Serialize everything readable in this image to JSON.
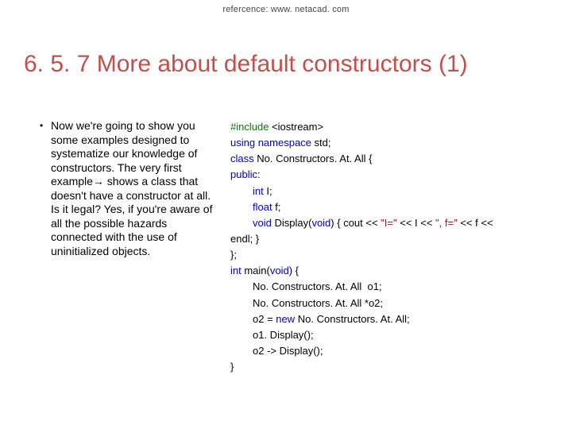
{
  "reference": "refercence: www. netacad. com",
  "title": "6. 5. 7 More about default constructors (1)",
  "bullet": "•",
  "paragraph_lead": "Now we're going to",
  "paragraph_rest": " show you some examples designed to systematize our knowledge of constructors. The very first example→ shows a class that doesn't have a constructor at all. Is it legal? Yes, if you're aware of all the possible hazards connected with the use of uninitialized objects.",
  "code": {
    "l1_a": "#include ",
    "l1_b": "<iostream>",
    "l2_a": "using namespace ",
    "l2_b": "std;",
    "l3_a": "class ",
    "l3_b": "No. Constructors. At. All {",
    "l4_a": "public",
    "l4_b": ":",
    "l5_a": "int ",
    "l5_b": "I;",
    "l6_a": "float ",
    "l6_b": "f;",
    "l7_a": "void ",
    "l7_b": "Display(",
    "l7_c": "void",
    "l7_d": ") { cout << ",
    "l7_e": "\"I=\"",
    "l7_f": " << I << ",
    "l7_g": "\", f=\"",
    "l7_h": " << f <<",
    "l8": "endl; }",
    "l9": "};",
    "l10_a": "int ",
    "l10_b": "main(",
    "l10_c": "void",
    "l10_d": ") {",
    "l11": "No. Constructors. At. All  o1;",
    "l12": "No. Constructors. At. All *o2;",
    "l13_a": "o2 = ",
    "l13_b": "new ",
    "l13_c": "No. Constructors. At. All;",
    "l14": "o1. Display();",
    "l15": "o2 -> Display();",
    "l16": "}"
  }
}
